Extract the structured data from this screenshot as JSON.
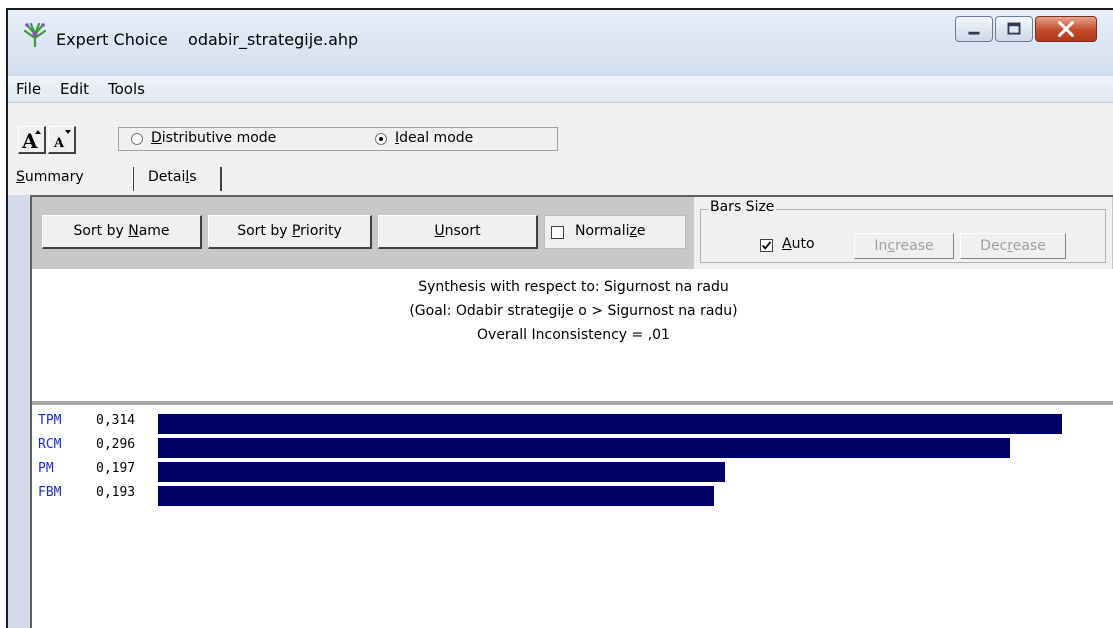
{
  "window": {
    "app_name": "Expert Choice",
    "file_name": "odabir_strategije.ahp"
  },
  "menu": [
    "File",
    "Edit",
    "Tools"
  ],
  "toolbar": {
    "modes": [
      {
        "label": "Distributive mode",
        "checked": false
      },
      {
        "label": "Ideal mode",
        "checked": true
      }
    ]
  },
  "tabs": [
    {
      "label": "Summary",
      "active": true
    },
    {
      "label": "Details",
      "active": false
    }
  ],
  "buttons": {
    "sort_by_name": "Sort by Name",
    "sort_by_priority": "Sort by Priority",
    "unsort": "Unsort",
    "normalize": "Normalize",
    "normalize_checked": false
  },
  "bars_size": {
    "legend": "Bars Size",
    "auto_label": "Auto",
    "auto_checked": true,
    "increase": "Increase",
    "decrease": "Decrease"
  },
  "synthesis": {
    "line1": "Synthesis with respect to: Sigurnost na radu",
    "line2": "(Goal: Odabir strategije o > Sigurnost na radu)",
    "line3": "Overall Inconsistency = ,01"
  },
  "results": [
    {
      "name": "TPM",
      "value_text": "0,314",
      "value": 0.314
    },
    {
      "name": "RCM",
      "value_text": "0,296",
      "value": 0.296
    },
    {
      "name": "PM",
      "value_text": "0,197",
      "value": 0.197
    },
    {
      "name": "FBM",
      "value_text": "0,193",
      "value": 0.193
    }
  ],
  "colors": {
    "bar": "#000066",
    "label": "#1a2ad6"
  }
}
